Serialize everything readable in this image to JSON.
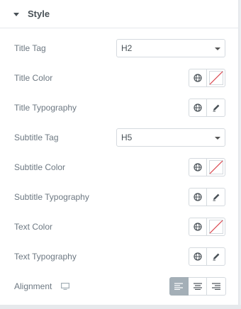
{
  "section": {
    "title": "Style"
  },
  "controls": {
    "title_tag": {
      "label": "Title Tag",
      "value": "H2"
    },
    "title_color": {
      "label": "Title Color"
    },
    "title_typography": {
      "label": "Title Typography"
    },
    "subtitle_tag": {
      "label": "Subtitle Tag",
      "value": "H5"
    },
    "subtitle_color": {
      "label": "Subtitle Color"
    },
    "subtitle_typography": {
      "label": "Subtitle Typography"
    },
    "text_color": {
      "label": "Text Color"
    },
    "text_typography": {
      "label": "Text Typography"
    },
    "alignment": {
      "label": "Alignment",
      "selected": "left",
      "options": [
        "left",
        "center",
        "right"
      ]
    }
  },
  "icons": {
    "global": "globe-icon",
    "no_color": "color-swatch-empty-icon",
    "edit": "pencil-icon",
    "device": "desktop-icon"
  },
  "colors": {
    "label": "#6d7882",
    "border": "#d5dadf",
    "active_alignment": "#a4afb7",
    "no_color_slash": "#d9414a"
  }
}
